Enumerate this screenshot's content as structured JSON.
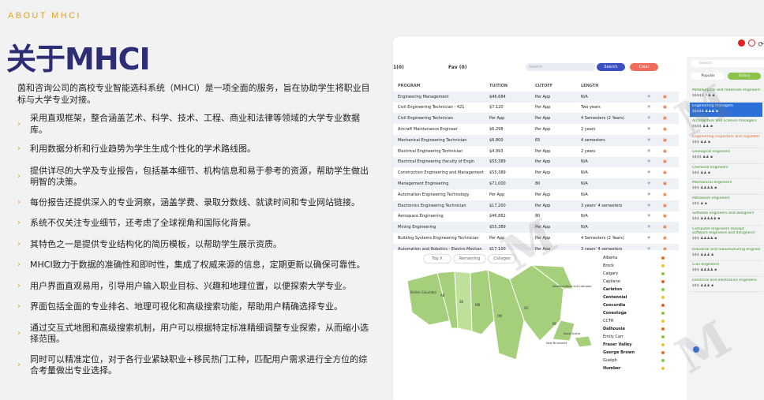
{
  "header": {
    "eyebrow": "ABOUT MHCI",
    "title": "关于MHCI"
  },
  "intro": "茵和咨询公司的高校专业智能选科系统（MHCI）是一项全面的服务，旨在协助学生将职业目标与大学专业对接。",
  "bullets": [
    "采用直观框架，整合涵盖艺术、科学、技术、工程、商业和法律等领域的大学专业数据库。",
    "利用数据分析和行业趋势为学生生成个性化的学术路线图。",
    "提供详尽的大学及专业报告，包括基本细节、机构信息和易于参考的资源，帮助学生做出明智的决策。",
    "每份报告还提供深入的专业洞察，涵盖学费、录取分数线、就读时间和专业网站链接。",
    "系统不仅关注专业细节，还考虑了全球视角和国际化背景。",
    "其特色之一是提供专业结构化的简历模板，以帮助学生展示资质。",
    "MHCI致力于数据的准确性和即时性，集成了权威来源的信息，定期更新以确保可靠性。",
    "用户界面直观易用，引导用户输入职业目标、兴趣和地理位置，以便探索大学专业。",
    "界面包括全面的专业排名、地理可视化和高级搜索功能，帮助用户精确选择专业。",
    "通过交互式地图和高级搜索机制，用户可以根据特定标准精细调整专业探索，从而缩小选择范围。",
    "同时可以精准定位，对于各行业紧缺职业+移民热门工种，匹配用户需求进行全方位的综合考量做出专业选择。"
  ],
  "app": {
    "toolbar": {
      "label_a": "1(0)",
      "label_b": "Fav (0)",
      "search_placeholder": "Search",
      "search_button": "Search",
      "clear_button": "Clear",
      "search_color": "#3a4fc1",
      "clear_color": "#ef6b5a"
    },
    "table": {
      "headers": [
        "PROGRAM",
        "TUITION",
        "CUTOFF",
        "LENGTH"
      ],
      "rows": [
        [
          "Engineering Management",
          "$46,684",
          "Per App",
          "N/A"
        ],
        [
          "Civil Engineering Technician - 421",
          "$7,120",
          "Per App",
          "Two years"
        ],
        [
          "Civil Engineering Technician",
          "Per App",
          "Per App",
          "4 Semesters (2 Years)"
        ],
        [
          "Aircraft Maintenance Engineer",
          "$6,298",
          "Per App",
          "2 years"
        ],
        [
          "Mechanical Engineering Technician",
          "$6,800",
          "65",
          "4 semesters"
        ],
        [
          "Electrical Engineering Technician",
          "$4,993",
          "Per App",
          "2 years"
        ],
        [
          "Electrical Engineering (faculty of Engin",
          "$55,389",
          "Per App",
          "N/A"
        ],
        [
          "Construction Engineering and Management",
          "$55,389",
          "Per App",
          "N/A"
        ],
        [
          "Management Engineering",
          "$71,000",
          "80",
          "N/A"
        ],
        [
          "Automation Engineering Technology",
          "Per App",
          "Per App",
          "N/A"
        ],
        [
          "Electronics Engineering Technician",
          "$17,200",
          "Per App",
          "3 years' 4 semesters"
        ],
        [
          "Aerospace Engineering",
          "$46,862",
          "80",
          "N/A"
        ],
        [
          "Mining Engineering",
          "$55,389",
          "Per App",
          "N/A"
        ],
        [
          "Building Systems Engineering Technician",
          "Per App",
          "Per App",
          "4 Semesters (2 Years)"
        ],
        [
          "Automation and Robotics - Electro-Mechan",
          "$17,100",
          "Per App",
          "3 years' 4 semesters"
        ]
      ]
    },
    "map_tabs": [
      "Top X",
      "Remaining",
      "Colleges"
    ],
    "map_labels": [
      "British Columbia",
      "AB",
      "SK",
      "MB",
      "ON",
      "QC",
      "NL",
      "PE",
      "Newfoundland and Labrador",
      "Nova Scotia",
      "New Brunswick"
    ],
    "cities": [
      "Alberta",
      "Brock",
      "Calgary",
      "Capilano",
      "Carleton",
      "Centennial",
      "Concordia",
      "Conestoga",
      "CCTR",
      "Dalhousie",
      "Emily Carr",
      "Fraser Valley",
      "George Brown",
      "Guelph",
      "Humber"
    ],
    "side": {
      "search_placeholder": "Search",
      "tab_popular": "Popular",
      "tab_salary": "Salary",
      "jobs": [
        {
          "title": "Metallurgical and materials engineers",
          "meta": "$$$$$ ⚬♟ ▪"
        },
        {
          "title": "Engineering managers",
          "meta": "$$$$$ ♟♟♟ ▪"
        },
        {
          "title": "Architecture and science managers",
          "meta": "$$$$ ♟♟ ▪"
        },
        {
          "title": "Engineering inspectors and regulatory off",
          "meta": "$$$ ♟♟ ▪"
        },
        {
          "title": "Geological engineers",
          "meta": "$$$$ ♟♟ ▪"
        },
        {
          "title": "Chemical engineers",
          "meta": "$$$ ♟♟ ▪"
        },
        {
          "title": "Mechanical engineers",
          "meta": "$$$ ♟♟♟♟ ▪"
        },
        {
          "title": "Petroleum engineers",
          "meta": "$$$ ♟ ▪"
        },
        {
          "title": "Software engineers and designers",
          "meta": "$$$ ♟♟♟♟♟ ▪"
        },
        {
          "title": "Computer engineers (except software engineers and designers)",
          "meta": "$$$ ♟♟♟♟ ▪"
        },
        {
          "title": "Industrial and manufacturing engineers",
          "meta": "$$$ ♟♟♟ ▪"
        },
        {
          "title": "Civil engineers",
          "meta": "$$$ ♟♟♟♟ ▪"
        },
        {
          "title": "Electrical and electronics engineers",
          "meta": "$$$ ♟♟♟ ▪"
        }
      ]
    }
  }
}
